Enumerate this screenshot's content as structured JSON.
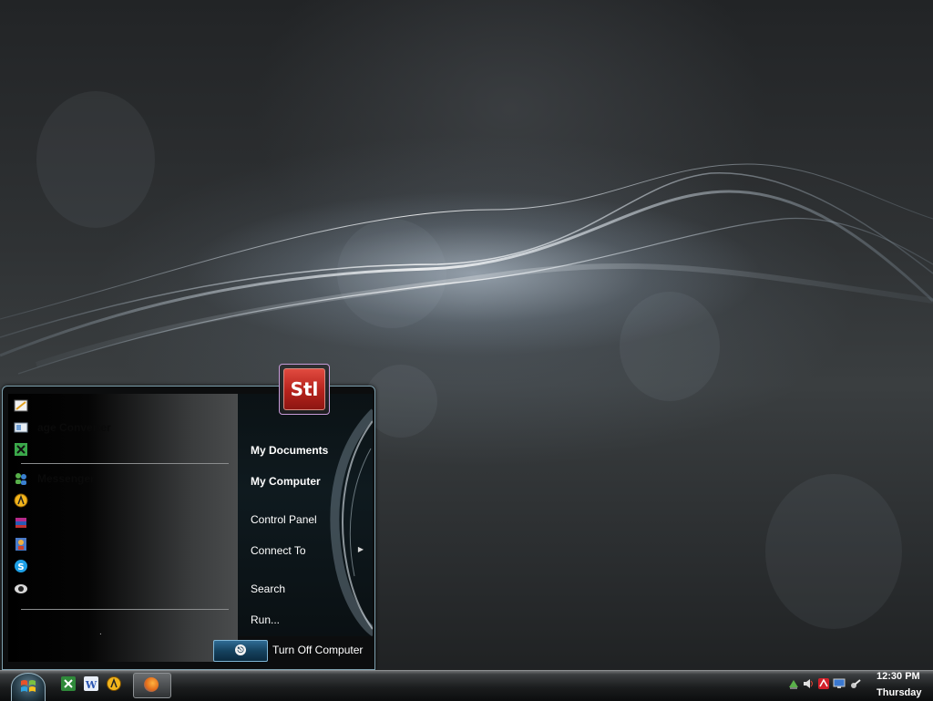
{
  "start_menu": {
    "user_picture_text": "Stl",
    "programs": [
      {
        "label": "",
        "icon": "paint-icon"
      },
      {
        "label": "age Converter",
        "icon": "converter-icon"
      },
      {
        "label": "",
        "icon": "xbox-icon"
      },
      {
        "label": "Messenger",
        "icon": "messenger-icon"
      },
      {
        "label": "",
        "icon": "aim-icon"
      },
      {
        "label": "",
        "icon": "winrar-icon"
      },
      {
        "label": "",
        "icon": "photo-viewer-icon"
      },
      {
        "label": "",
        "icon": "skype-icon"
      },
      {
        "label": "",
        "icon": "webcam-icon"
      }
    ],
    "all_programs_label": ".",
    "places": [
      {
        "label": "My Documents",
        "bold": true
      },
      {
        "label": "My Computer",
        "bold": true
      },
      {
        "label": "Control Panel",
        "bold": false
      },
      {
        "label": "Connect To",
        "bold": false,
        "submenu": true
      },
      {
        "label": "Search",
        "bold": false
      },
      {
        "label": "Run...",
        "bold": false
      }
    ],
    "turn_off_label": "Turn Off Computer"
  },
  "taskbar": {
    "quick_launch": [
      "excel-icon",
      "word-icon",
      "aim-icon"
    ],
    "active_task": "firefox-icon",
    "tray_icons": [
      "network-icon",
      "volume-icon",
      "antivirus-icon",
      "display-icon",
      "safely-remove-icon"
    ],
    "clock_time": "12:30 PM",
    "clock_day": "Thursday"
  },
  "colors": {
    "menu_border": "#7fa2b0",
    "power_button": "#15425f",
    "user_tile": "#b4221c"
  }
}
